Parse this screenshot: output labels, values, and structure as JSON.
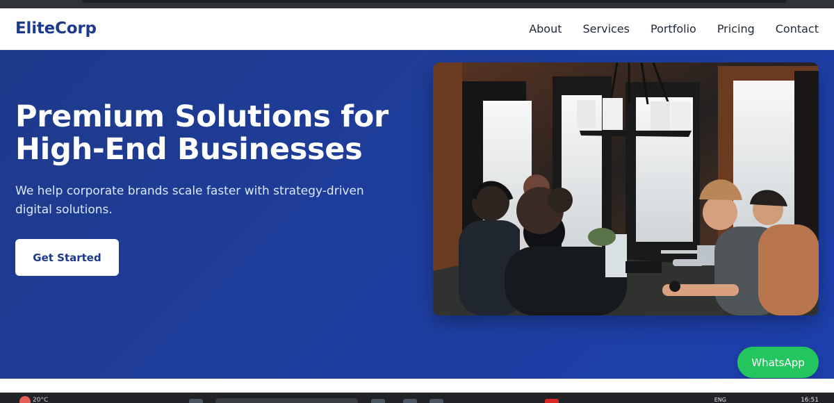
{
  "brand": {
    "name": "EliteCorp",
    "color": "#1e3a8a"
  },
  "navigation": {
    "links": [
      "About",
      "Services",
      "Portfolio",
      "Pricing",
      "Contact"
    ]
  },
  "hero": {
    "title": "Premium Solutions for High-End Businesses",
    "subtitle": "We help corporate brands scale faster with strategy-driven digital solutions.",
    "cta_label": "Get Started",
    "background_colors": [
      "#1e3a8a",
      "#1e40af"
    ],
    "image_semantic": "team-meeting-photo"
  },
  "floating_action": {
    "label": "WhatsApp",
    "color": "#22c55e"
  },
  "taskbar": {
    "temperature": "20°C",
    "time": "16:51",
    "language": "ENG",
    "icons": [
      "weather-icon",
      "windows-start-icon",
      "search-box",
      "file-explorer-icon",
      "edge-icon",
      "store-icon",
      "chrome-icon"
    ]
  }
}
